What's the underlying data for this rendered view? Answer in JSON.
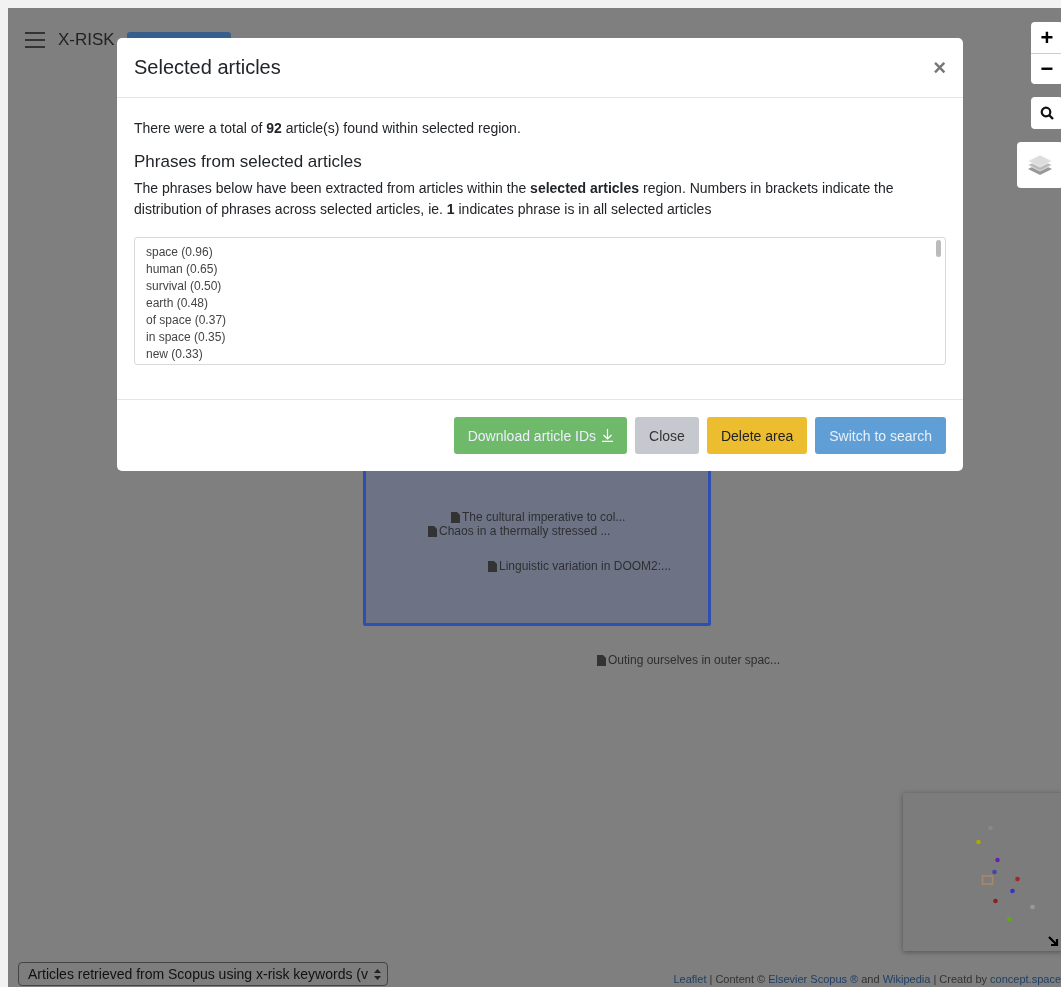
{
  "app": {
    "title": "X-RISK"
  },
  "map_controls": {
    "zoom_in": "+",
    "zoom_out": "−"
  },
  "map_labels": [
    {
      "text": "The cultural imperative to col..."
    },
    {
      "text": "Chaos in a thermally stressed ..."
    },
    {
      "text": "Linguistic variation in DOOM2:..."
    },
    {
      "text": "Outing ourselves in outer spac..."
    }
  ],
  "modal": {
    "title": "Selected articles",
    "close": "×",
    "summary": "There were a total of **92** article(s) found within selected region.",
    "heading": "Phrases from selected articles",
    "description": "The phrases below have been extracted from articles within the **selected articles** region. Numbers in brackets indicate the distribution of phrases across selected articles, ie. **1** indicates phrase is in all selected articles",
    "phrases": [
      "space (0.96)",
      "human (0.65)",
      "survival (0.50)",
      "earth (0.48)",
      "of space (0.37)",
      "in space (0.35)",
      "new (0.33)"
    ],
    "buttons": [
      {
        "label": "Download article IDs",
        "kind": "success",
        "icon": true
      },
      {
        "label": "Close",
        "kind": "secondary",
        "icon": false
      },
      {
        "label": "Delete area",
        "kind": "warning",
        "icon": false
      },
      {
        "label": "Switch to search",
        "kind": "primary",
        "icon": false
      }
    ]
  },
  "layer_select": {
    "value": "Articles retrieved from Scopus using x-risk keywords (v"
  },
  "attribution": [
    {
      "text": "Leaflet",
      "kind": "link"
    },
    {
      "text": " | Content © ",
      "kind": "text"
    },
    {
      "text": "Elsevier Scopus ®",
      "kind": "link"
    },
    {
      "text": " and ",
      "kind": "text"
    },
    {
      "text": "Wikipedia",
      "kind": "link"
    },
    {
      "text": " | Creatd by ",
      "kind": "text"
    },
    {
      "text": "concept.space",
      "kind": "link"
    }
  ]
}
